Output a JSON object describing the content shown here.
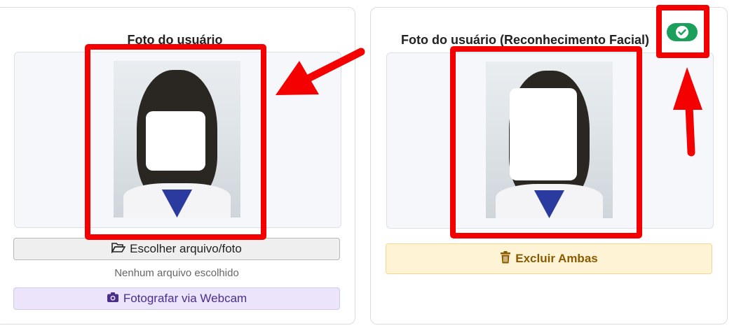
{
  "left_card": {
    "title": "Foto do usuário",
    "choose_file_label": "Escolher arquivo/foto",
    "no_file_text": "Nenhum arquivo escolhido",
    "webcam_label": "Fotografar via Webcam"
  },
  "right_card": {
    "title": "Foto do usuário (Reconhecimento Facial)",
    "delete_both_label": "Excluir Ambas",
    "recognition_status_icon": "check-circle-icon"
  },
  "colors": {
    "annotation_red": "#f50000",
    "status_green": "#1aa05a",
    "webcam_purple": "#ece4fb",
    "delete_yellow": "#fff3d6"
  }
}
